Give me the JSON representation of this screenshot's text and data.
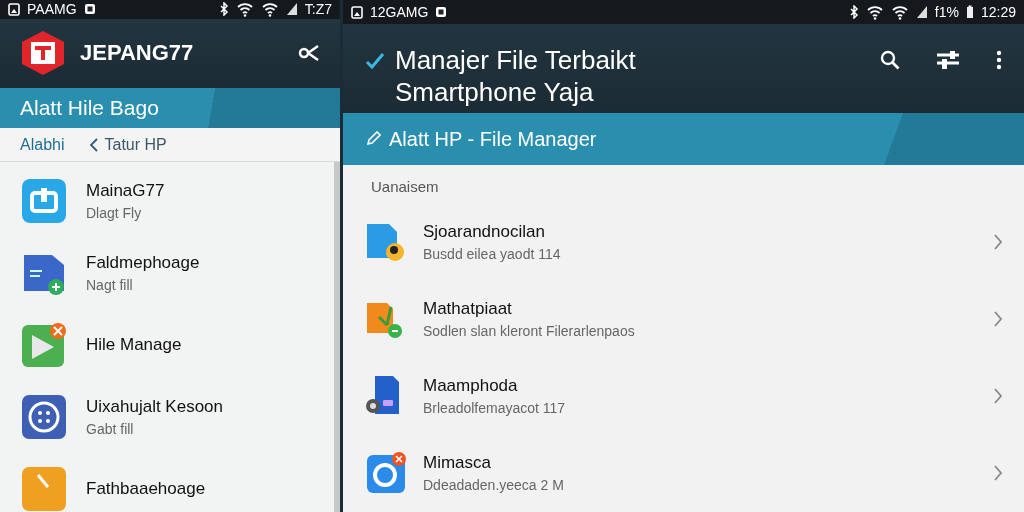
{
  "left_pane": {
    "status_bar": {
      "carrier": "PAAMG",
      "time": "T:Z7"
    },
    "app_bar": {
      "title": "JEPANG77"
    },
    "banner": {
      "title": "Alatt Hile Bago"
    },
    "breadcrumb": [
      {
        "label": "Alabhi",
        "selected": true
      },
      {
        "label": "Tatur HP",
        "selected": false
      }
    ],
    "items": [
      {
        "title": "MainaG77",
        "subtitle": "Dlagt Fly"
      },
      {
        "title": "Faldmephoage",
        "subtitle": "Nagt fill"
      },
      {
        "title": "Hile Manage"
      },
      {
        "title": "Uixahujalt Kesoon",
        "subtitle": "Gabt fill"
      },
      {
        "title": "Fathbaaehoage"
      }
    ]
  },
  "right_pane": {
    "status_bar": {
      "carrier": "12GAMG",
      "battery": "f1%",
      "time": "12:29"
    },
    "app_bar": {
      "title": "Manajer File Terbaikt Smartphone Yaja"
    },
    "banner": {
      "title": "Alatt  HP - File Manager"
    },
    "section": "Uanaisem",
    "items": [
      {
        "title": "Sjoarandnocilan",
        "subtitle": "Busdd eilea yaodt 114"
      },
      {
        "title": "Mathatpiaat",
        "subtitle": "Sodlen  slan kleront Filerarlenpaos"
      },
      {
        "title": "Maamphoda",
        "subtitle": "Brleadolfemayacot  117"
      },
      {
        "title": "Mimasca",
        "subtitle": "Ddeadaden.yeeca 2 M"
      }
    ]
  }
}
